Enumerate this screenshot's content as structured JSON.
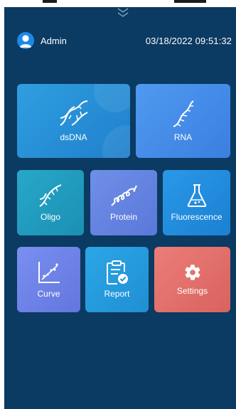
{
  "header": {
    "user_name": "Admin",
    "datetime": "03/18/2022 09:51:32"
  },
  "tiles": {
    "dsdna": "dsDNA",
    "rna": "RNA",
    "oligo": "Oligo",
    "protein": "Protein",
    "fluorescence": "Fluorescence",
    "curve": "Curve",
    "report": "Report",
    "settings": "Settings"
  },
  "icons": {
    "avatar": "user-avatar-icon",
    "pull_down": "double-chevron-down-icon",
    "dsdna": "dna-helix-icon",
    "rna": "rna-strand-icon",
    "oligo": "oligo-strand-icon",
    "protein": "protein-coil-icon",
    "fluorescence": "flask-icon",
    "curve": "scatter-curve-icon",
    "report": "clipboard-check-icon",
    "settings": "gear-icon"
  },
  "colors": {
    "background": "#0b3a62",
    "settings_tile": "#e06d69",
    "avatar": "#1e88e5"
  }
}
